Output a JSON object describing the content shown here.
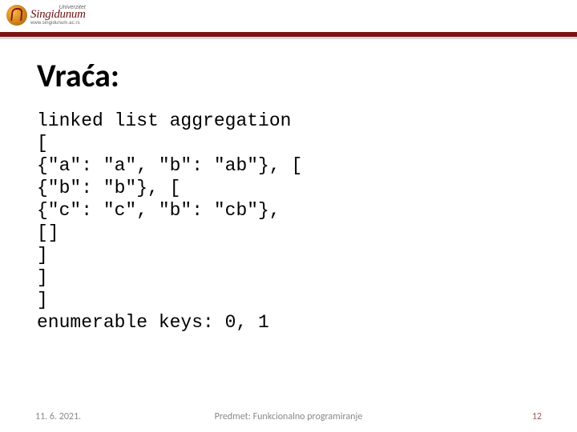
{
  "logo": {
    "university_word": "Univerzitet",
    "name": "Singidunum",
    "url": "www.singidunum.ac.rs"
  },
  "title": "Vraća:",
  "code_lines": [
    "linked list aggregation",
    "[",
    "{\"a\": \"a\", \"b\": \"ab\"}, [",
    "{\"b\": \"b\"}, [",
    "{\"c\": \"c\", \"b\": \"cb\"},",
    "[]",
    "]",
    "]",
    "]",
    "enumerable keys: 0, 1"
  ],
  "footer": {
    "date": "11. 6. 2021.",
    "subject": "Predmet: Funkcionalno programiranje",
    "page": "12"
  }
}
